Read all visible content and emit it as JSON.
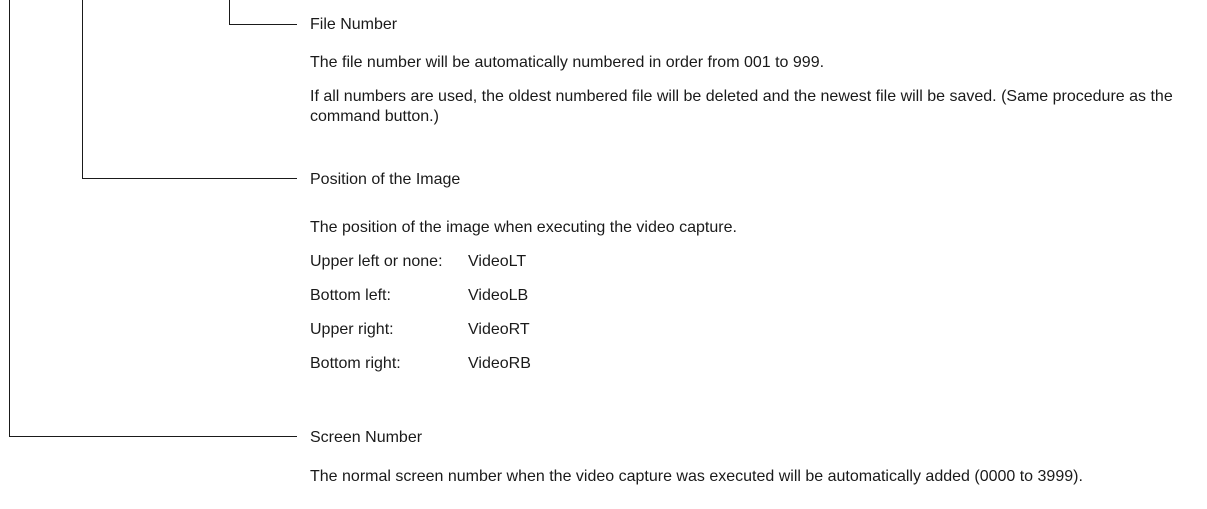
{
  "sections": {
    "file_number": {
      "heading": "File Number",
      "paragraphs": [
        "The file number will be automatically numbered in order from 001 to 999.",
        "If all numbers are used, the oldest numbered file will be deleted and the newest file will be saved. (Same procedure as the command button.)"
      ]
    },
    "position": {
      "heading": "Position of the Image",
      "description": "The position of the image when executing the video capture.",
      "rows": [
        {
          "label": "Upper left or none:",
          "value": "VideoLT"
        },
        {
          "label": "Bottom left:",
          "value": "VideoLB"
        },
        {
          "label": "Upper right:",
          "value": "VideoRT"
        },
        {
          "label": "Bottom right:",
          "value": "VideoRB"
        }
      ]
    },
    "screen_number": {
      "heading": "Screen Number",
      "description": "The normal screen number when the video capture was executed will be automatically added (0000 to 3999)."
    }
  }
}
